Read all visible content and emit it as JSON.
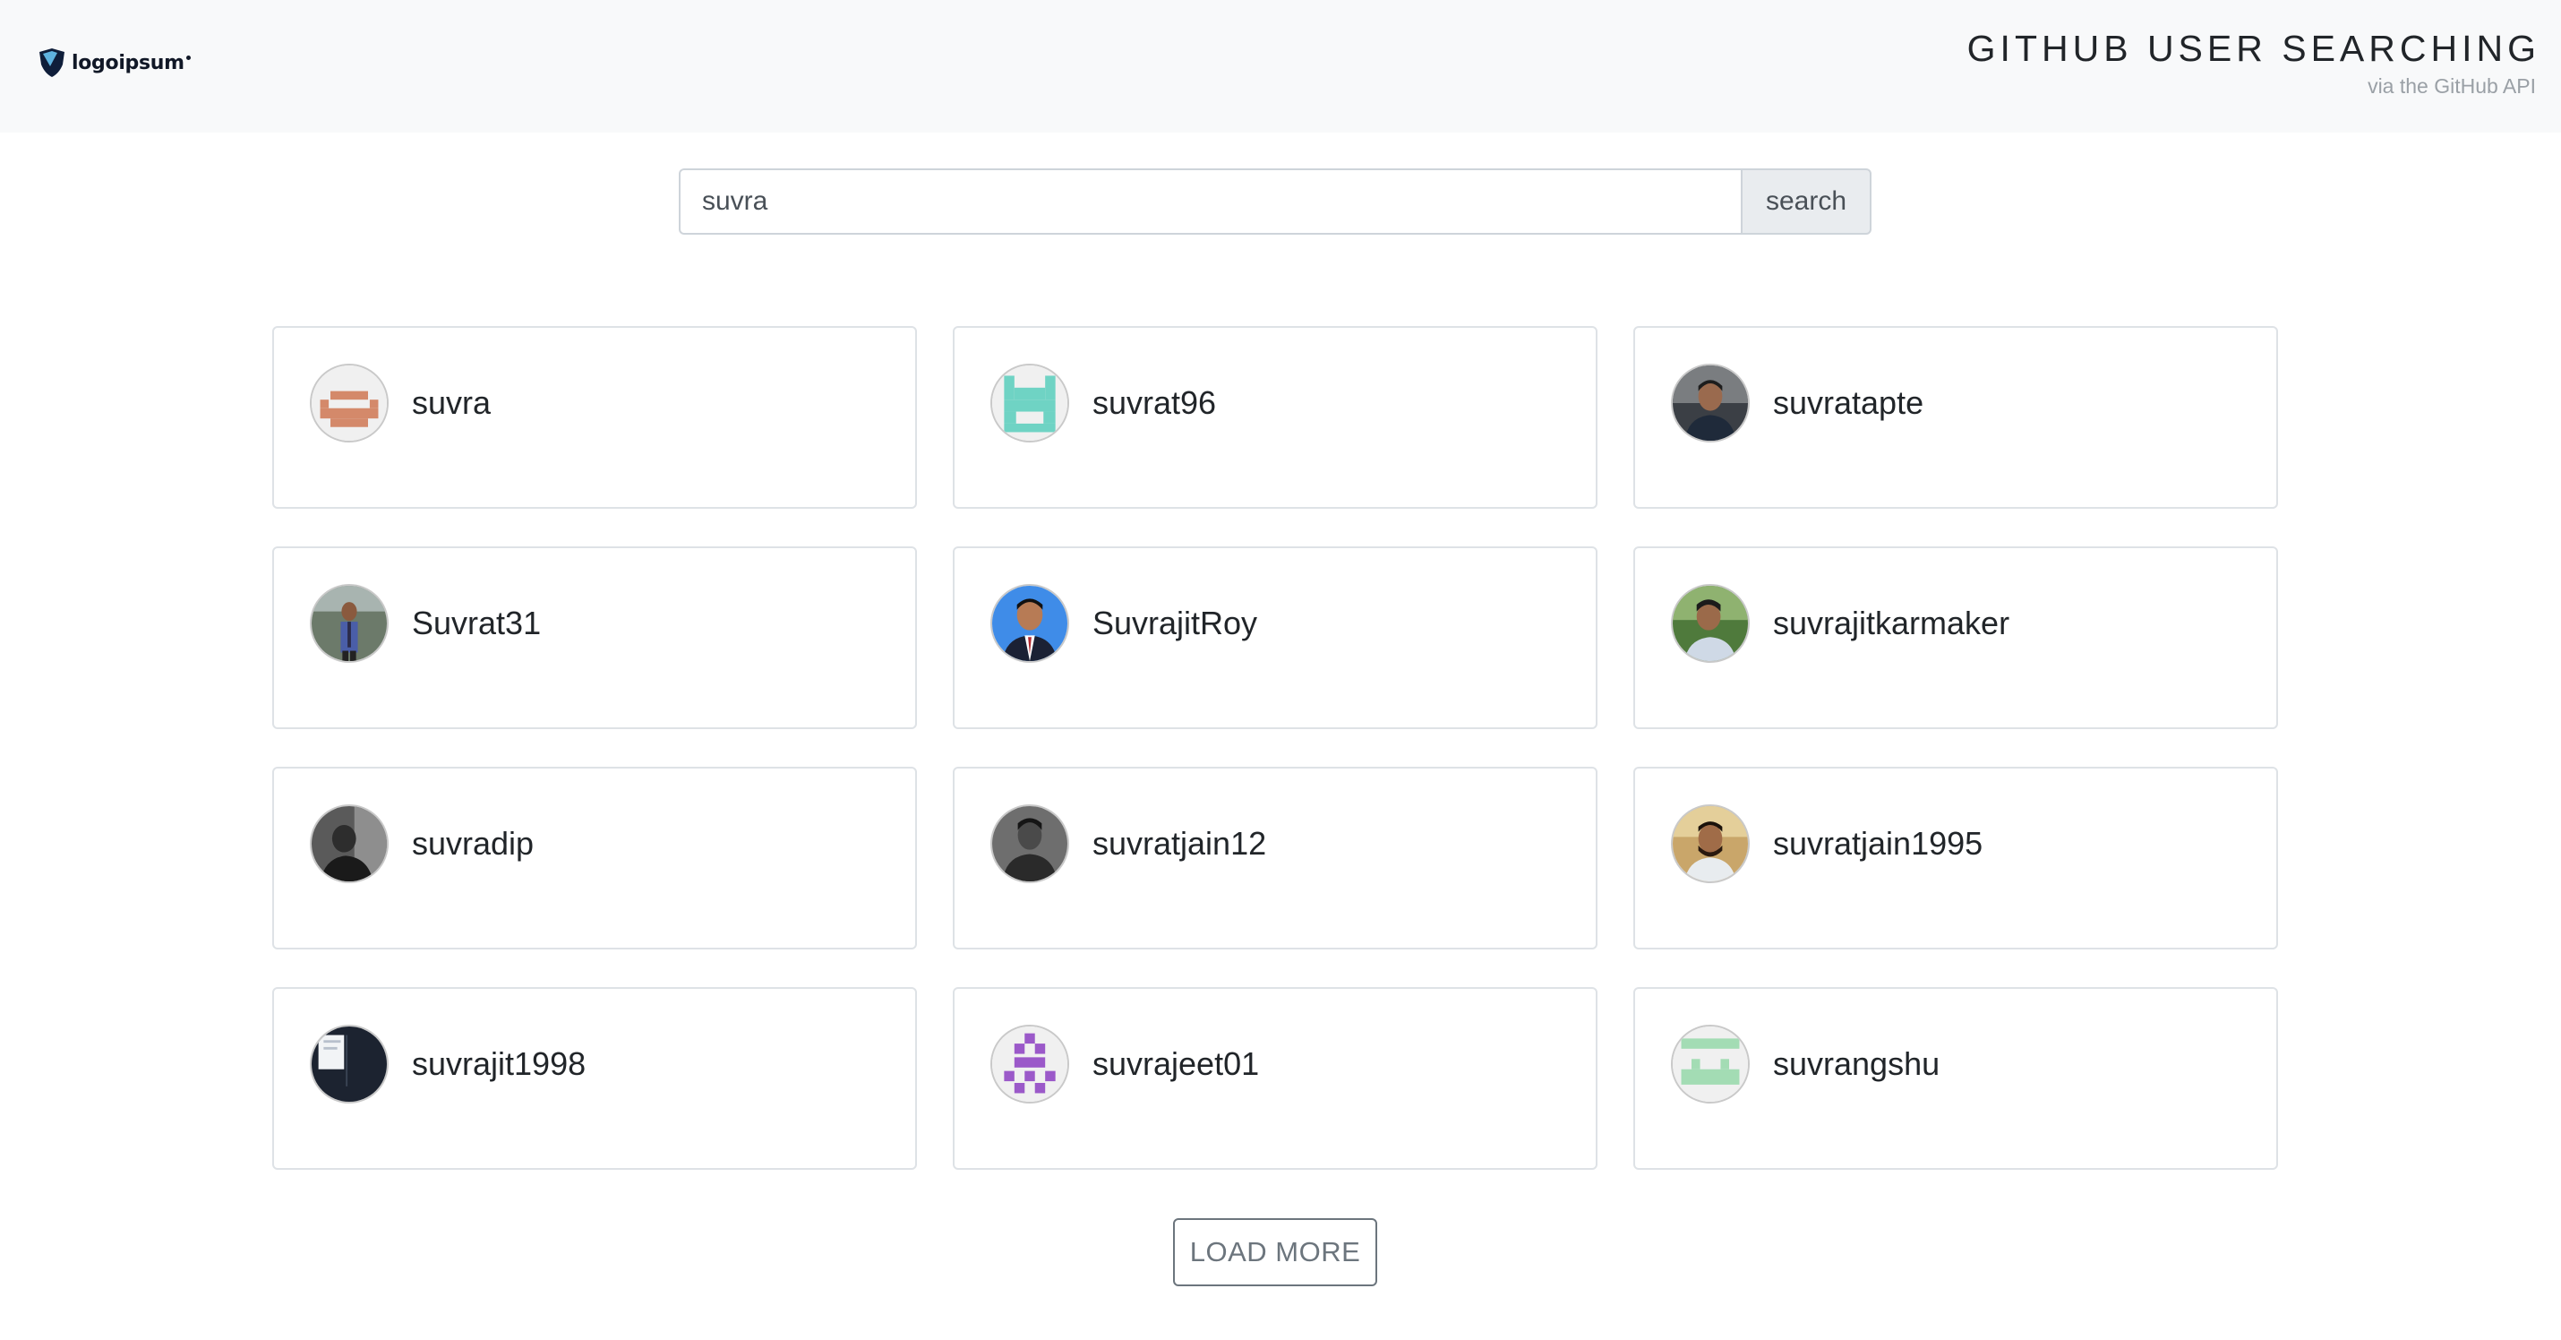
{
  "header": {
    "logo_text": "logoipsum",
    "title": "GITHUB USER SEARCHING",
    "subtitle": "via the GitHub API"
  },
  "search": {
    "value": "suvra",
    "button_label": "search"
  },
  "users": [
    {
      "login": "suvra",
      "avatar": "identicon-orange"
    },
    {
      "login": "suvrat96",
      "avatar": "identicon-teal"
    },
    {
      "login": "suvratapte",
      "avatar": "photo"
    },
    {
      "login": "Suvrat31",
      "avatar": "photo"
    },
    {
      "login": "SuvrajitRoy",
      "avatar": "photo"
    },
    {
      "login": "suvrajitkarmaker",
      "avatar": "photo"
    },
    {
      "login": "suvradip",
      "avatar": "photo"
    },
    {
      "login": "suvratjain12",
      "avatar": "photo"
    },
    {
      "login": "suvratjain1995",
      "avatar": "photo"
    },
    {
      "login": "suvrajit1998",
      "avatar": "photo"
    },
    {
      "login": "suvrajeet01",
      "avatar": "identicon-purple"
    },
    {
      "login": "suvrangshu",
      "avatar": "identicon-green"
    }
  ],
  "load_more_label": "LOAD MORE",
  "colors": {
    "header_bg": "#f8f9fa",
    "card_border": "#dee2e6",
    "identicon_orange": "#d4896a",
    "identicon_teal": "#6fd3c4",
    "identicon_purple": "#9b59c9",
    "identicon_green": "#a3dcb4"
  }
}
